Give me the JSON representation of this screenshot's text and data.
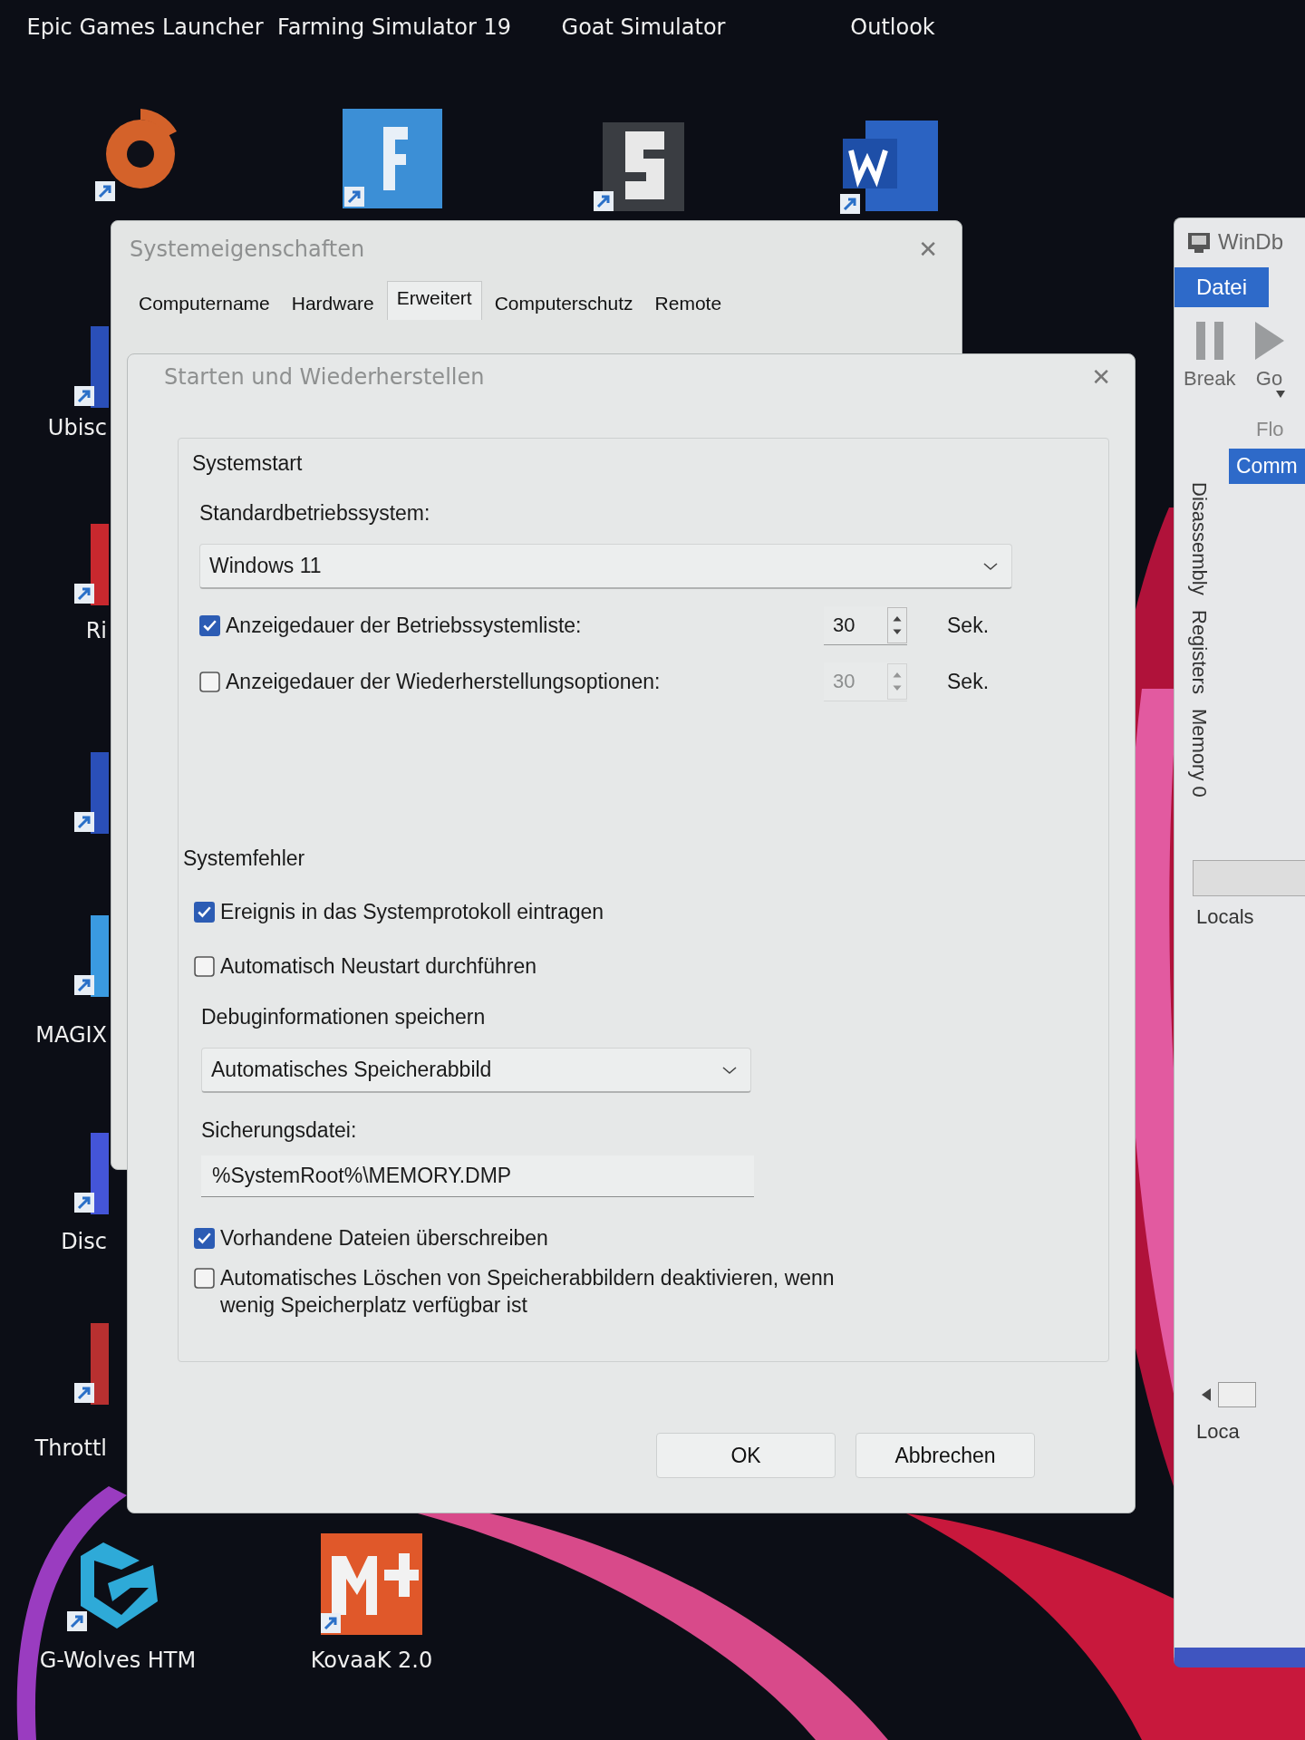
{
  "desktop": {
    "top_labels": [
      {
        "label": "Epic Games Launcher"
      },
      {
        "label": "Farming Simulator 19"
      },
      {
        "label": "Goat Simulator"
      },
      {
        "label": "Outlook"
      }
    ],
    "left_labels": [
      {
        "label": "Ubisc"
      },
      {
        "label": "Ri"
      },
      {
        "label": "MAGIX"
      },
      {
        "label": "Disc"
      },
      {
        "label": "Throttl"
      }
    ],
    "bottom_icons": [
      {
        "label": "G-Wolves HTM"
      },
      {
        "label": "KovaaK 2.0"
      }
    ]
  },
  "system_properties": {
    "title": "Systemeigenschaften",
    "close": "✕",
    "tabs": [
      {
        "label": "Computername",
        "selected": false
      },
      {
        "label": "Hardware",
        "selected": false
      },
      {
        "label": "Erweitert",
        "selected": true
      },
      {
        "label": "Computerschutz",
        "selected": false
      },
      {
        "label": "Remote",
        "selected": false
      }
    ]
  },
  "dialog": {
    "title": "Starten und Wiederherstellen",
    "close": "✕",
    "startup": {
      "heading": "Systemstart",
      "os_label": "Standardbetriebssystem:",
      "os_value": "Windows 11",
      "timeouts": [
        {
          "label": "Anzeigedauer der Betriebssystemliste:",
          "checked": true,
          "value": "30",
          "disabled": false,
          "unit": "Sek."
        },
        {
          "label": "Anzeigedauer der Wiederherstellungsoptionen:",
          "checked": false,
          "value": "30",
          "disabled": true,
          "unit": "Sek."
        }
      ]
    },
    "failure": {
      "heading": "Systemfehler",
      "options": [
        {
          "label": "Ereignis in das Systemprotokoll eintragen",
          "checked": true
        },
        {
          "label": "Automatisch Neustart durchführen",
          "checked": false
        }
      ],
      "debug_label": "Debuginformationen speichern",
      "debug_value": "Automatisches Speicherabbild",
      "dump_label": "Sicherungsdatei:",
      "dump_value": "%SystemRoot%\\MEMORY.DMP",
      "dump_options": [
        {
          "label": "Vorhandene Dateien überschreiben",
          "checked": true
        },
        {
          "label": "Automatisches Löschen von Speicherabbildern deaktivieren, wenn wenig Speicherplatz verfügbar ist",
          "checked": false
        }
      ]
    },
    "buttons": [
      "OK",
      "Abbrechen"
    ]
  },
  "debugger": {
    "title": "WinDb",
    "menu": [
      {
        "label": "Datei",
        "selected": true
      }
    ],
    "toolbar": [
      {
        "label": "Break"
      },
      {
        "label": "Go"
      }
    ],
    "group_label": "Flo",
    "tab": {
      "label": "Comm",
      "selected": true
    },
    "side_tabs": [
      "Disassembly",
      "Registers",
      "Memory 0"
    ],
    "locals_label": "Locals",
    "bottom_tab": "Loca"
  }
}
